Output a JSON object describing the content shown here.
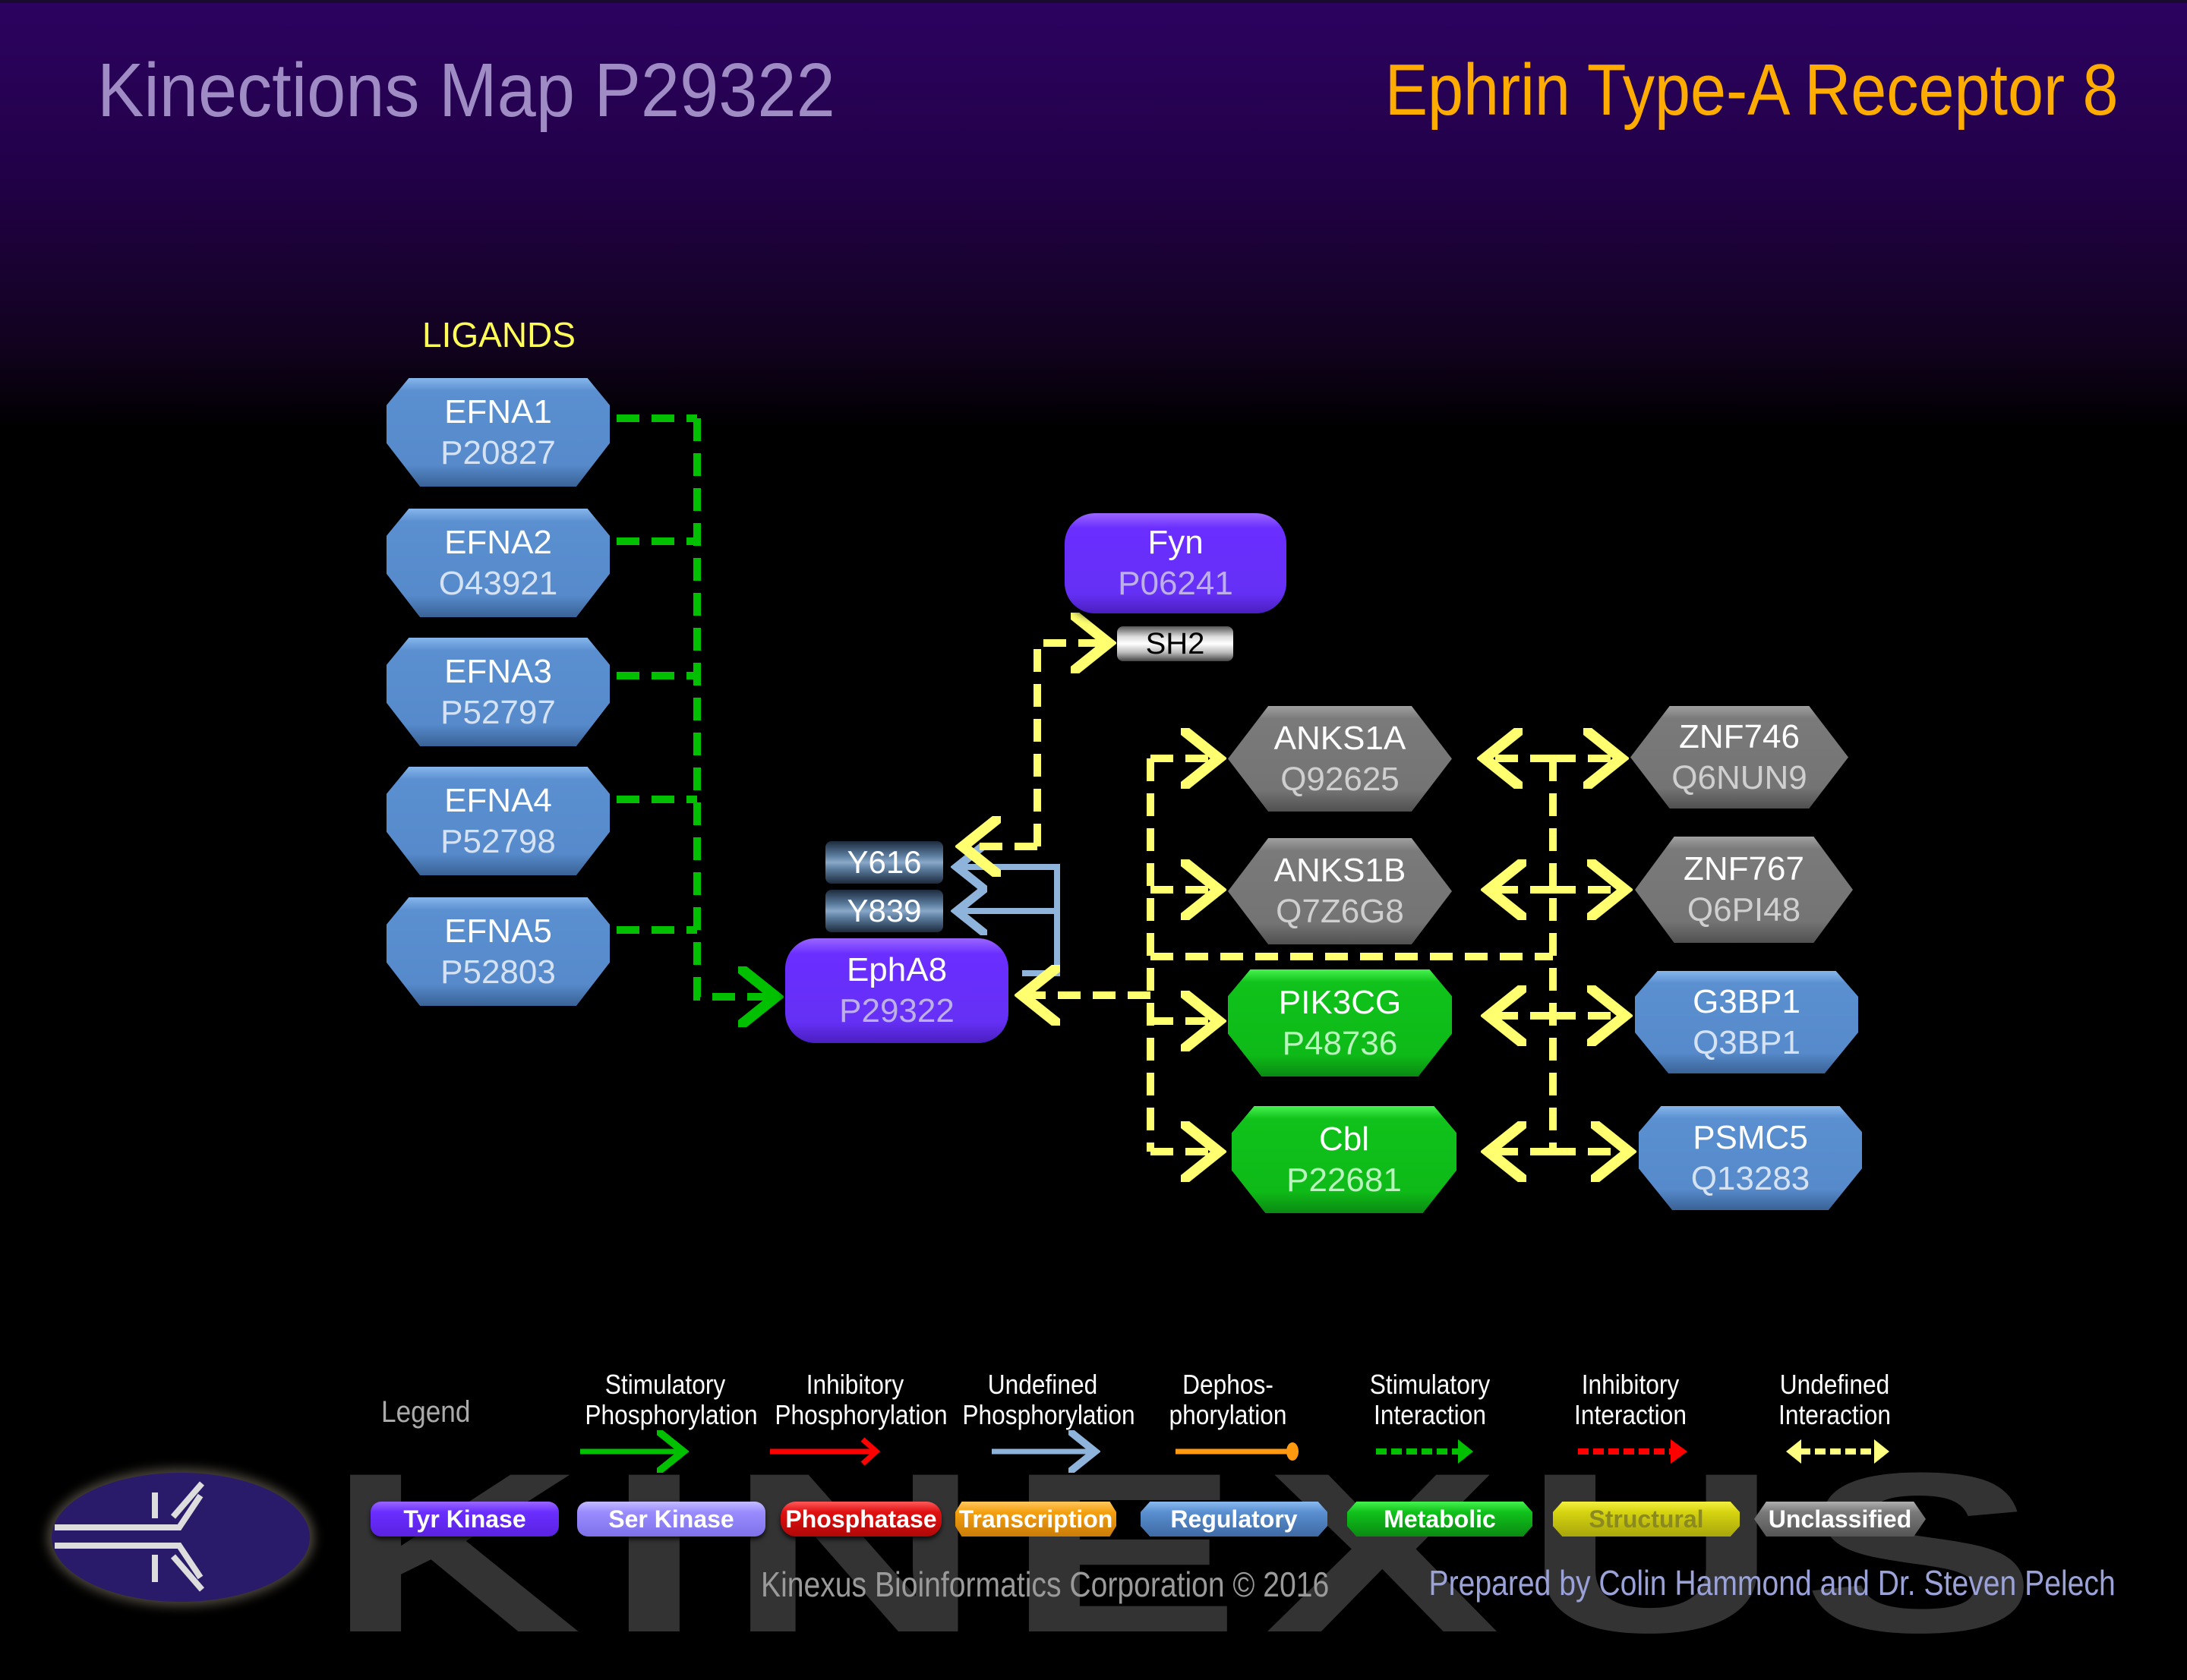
{
  "header": {
    "title": "Kinections Map P29322",
    "protein_name": "Ephrin Type-A Receptor  8"
  },
  "ligands_label": "LIGANDS",
  "ligands": [
    {
      "name": "EFNA1",
      "accession": "P20827",
      "category": "Regulatory"
    },
    {
      "name": "EFNA2",
      "accession": "O43921",
      "category": "Regulatory"
    },
    {
      "name": "EFNA3",
      "accession": "P52797",
      "category": "Regulatory"
    },
    {
      "name": "EFNA4",
      "accession": "P52798",
      "category": "Regulatory"
    },
    {
      "name": "EFNA5",
      "accession": "P52803",
      "category": "Regulatory"
    }
  ],
  "center": {
    "name": "EphA8",
    "accession": "P29322",
    "category": "Tyr Kinase"
  },
  "sites": [
    "Y616",
    "Y839"
  ],
  "upstream": {
    "name": "Fyn",
    "accession": "P06241",
    "category": "Tyr Kinase",
    "domain": "SH2"
  },
  "partners_left": [
    {
      "name": "ANKS1A",
      "accession": "Q92625",
      "category": "Unclassified"
    },
    {
      "name": "ANKS1B",
      "accession": "Q7Z6G8",
      "category": "Unclassified"
    },
    {
      "name": "PIK3CG",
      "accession": "P48736",
      "category": "Metabolic"
    },
    {
      "name": "Cbl",
      "accession": "P22681",
      "category": "Metabolic"
    }
  ],
  "partners_right": [
    {
      "name": "ZNF746",
      "accession": "Q6NUN9",
      "category": "Unclassified"
    },
    {
      "name": "ZNF767",
      "accession": "Q6PI48",
      "category": "Unclassified"
    },
    {
      "name": "G3BP1",
      "accession": "Q3BP1",
      "category": "Regulatory"
    },
    {
      "name": "PSMC5",
      "accession": "Q13283",
      "category": "Regulatory"
    }
  ],
  "edges": [
    {
      "from": "EFNA1-5",
      "to": "EphA8",
      "type": "Stimulatory Interaction"
    },
    {
      "from": "EphA8",
      "to": "Y616",
      "type": "Undefined Phosphorylation"
    },
    {
      "from": "EphA8",
      "to": "Y839",
      "type": "Undefined Phosphorylation"
    },
    {
      "from": "Y616",
      "to": "Fyn SH2",
      "type": "Undefined Interaction"
    },
    {
      "from": "EphA8",
      "to": "ANKS1A, ANKS1B, PIK3CG, Cbl",
      "type": "Undefined Interaction"
    },
    {
      "from": "ANKS1A, ANKS1B, PIK3CG, Cbl",
      "to": "ZNF746, ZNF767, G3BP1, PSMC5",
      "type": "Undefined Interaction"
    }
  ],
  "legend": {
    "title": "Legend",
    "edge_types": [
      {
        "line1": "Stimulatory",
        "line2": "Phosphorylation",
        "color": "#00c000",
        "style": "solid-arrow"
      },
      {
        "line1": "Inhibitory",
        "line2": "Phosphorylation",
        "color": "#ff0000",
        "style": "solid-arrow"
      },
      {
        "line1": "Undefined",
        "line2": "Phosphorylation",
        "color": "#8fb4dc",
        "style": "solid-arrow"
      },
      {
        "line1": "Dephos-",
        "line2": "phorylation",
        "color": "#ff9a10",
        "style": "solid-ball"
      },
      {
        "line1": "Stimulatory",
        "line2": "Interaction",
        "color": "#00c000",
        "style": "dashed-arrow"
      },
      {
        "line1": "Inhibitory",
        "line2": "Interaction",
        "color": "#ff0000",
        "style": "dashed-arrow"
      },
      {
        "line1": "Undefined",
        "line2": "Interaction",
        "color": "#ffff80",
        "style": "dashed-double-arrow"
      }
    ],
    "categories": [
      {
        "label": "Tyr Kinase",
        "color": "#6a2eff",
        "text_color": "#ffffff"
      },
      {
        "label": "Ser Kinase",
        "color": "#9a8cff",
        "text_color": "#ffffff"
      },
      {
        "label": "Phosphatase",
        "color": "#e01010",
        "text_color": "#ffffff"
      },
      {
        "label": "Transcription",
        "color": "#f5a010",
        "text_color": "#ffffff"
      },
      {
        "label": "Regulatory",
        "color": "#5a8fd0",
        "text_color": "#ffffff"
      },
      {
        "label": "Metabolic",
        "color": "#10c21b",
        "text_color": "#ffffff"
      },
      {
        "label": "Structural",
        "color": "#d6d410",
        "text_color": "#8a8a20"
      },
      {
        "label": "Unclassified",
        "color": "#7a7a7a",
        "text_color": "#ffffff"
      }
    ]
  },
  "watermark": "KINEXUS",
  "footer": {
    "copyright": "Kinexus Bioinformatics Corporation © 2016",
    "prepared_by": "Prepared by Colin Hammond and Dr. Steven Pelech"
  }
}
